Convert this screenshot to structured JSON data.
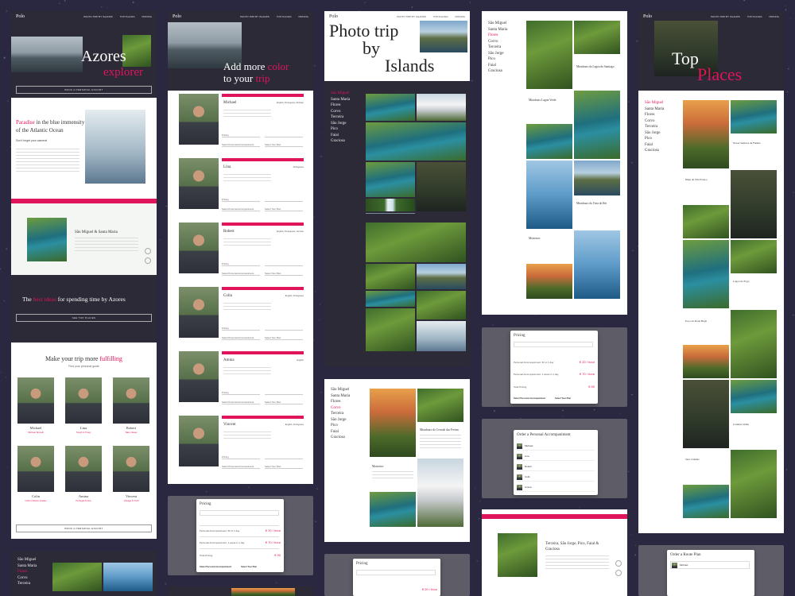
{
  "brand": "Polo",
  "nav": [
    "PHOTO TRIP BY ISLANDS",
    "TOP PLACES",
    "PRICING"
  ],
  "hero": {
    "title": "Azores",
    "subtitle": "explorer",
    "cta": "BOOK A PERSONAL ESCORT"
  },
  "paradise": {
    "highlight": "Paradise",
    "rest": " in the blue immensity of the Atlantic Ocean",
    "tagline": "Don't forget your camera!"
  },
  "region": {
    "title": "São Miguel & Santa Maria"
  },
  "best": {
    "prefix": "The ",
    "highlight": "best ideas",
    "suffix": " for spending time by Azores",
    "cta": "SEE TOP PLACES"
  },
  "guides_section": {
    "prefix": "Make your trip more ",
    "highlight": "fulfilling",
    "sub": "Find your personal guide",
    "cta": "BOOK A PERSONAL ESCORT"
  },
  "guides": [
    {
      "name": "Michael",
      "role": "Michael Spinelli"
    },
    {
      "name": "Lina",
      "role": "Tough & Trusty"
    },
    {
      "name": "Robert",
      "role": "Take it Easy"
    },
    {
      "name": "Colin",
      "role": "Colin's Nature Guides"
    },
    {
      "name": "Amina",
      "role": "Portugal Amina"
    },
    {
      "name": "Vincent",
      "role": "Vintage & Vivid"
    }
  ],
  "addmore": {
    "line1": "Add more ",
    "hl1": "color",
    "line2": "to your ",
    "hl2": "trip"
  },
  "guide_cards": [
    {
      "name": "Michael",
      "tag": "English, Portuguese, Russian"
    },
    {
      "name": "Lina",
      "tag": "Portuguese"
    },
    {
      "name": "Robert",
      "tag": "English, Portuguese, German"
    },
    {
      "name": "Colin",
      "tag": "English, Portuguese"
    },
    {
      "name": "Amina",
      "tag": "English"
    },
    {
      "name": "Vincent",
      "tag": "English, Portuguese"
    }
  ],
  "form_fields": {
    "a": "Pricing",
    "b": "Select Personal Accompaniment",
    "c": "Select Tour Plan"
  },
  "phototrip": {
    "line1": "Photo trip",
    "line2": "by",
    "line3": "Islands"
  },
  "islands": [
    "São Miguel",
    "Santa Maria",
    "Flores",
    "Corvo",
    "Terceira",
    "São Jorge",
    "Pico",
    "Faial",
    "Graciosa"
  ],
  "places_mid": [
    "Miradouro Lagoa Verde",
    "Miradouro da Vista do Rei",
    "Mosteiros",
    "Miradouro da Lagoa do Santiago",
    "Miradouro do Cerrado das Freiras"
  ],
  "place_right": [
    "Nossa Senhora de Fátima",
    "Ilhéu de Vila Franca",
    "Lagoa do Fogo",
    "Poço da Dona Beija",
    "Caldeira Velha",
    "Sete Cidades"
  ],
  "pricing": {
    "title": "Pricing",
    "row1": "Personal Accompaniment: 6h in 1 day",
    "row2": "Personal Accompaniment: 1 week in 1 day",
    "row3": "Total Pricing",
    "p1": "€ 20 / hour",
    "p2": "€ 70 / hour",
    "p3": "€ 90",
    "b1": "Select Personal Accompaniment",
    "b2": "Select Tour Plan"
  },
  "order": {
    "title": "Order a Personal Accompaniment",
    "items": [
      "Michael",
      "Lina",
      "Robert",
      "Colin",
      "Amina"
    ]
  },
  "route": {
    "title": "Order a Route Plan",
    "item": "Michael"
  },
  "tiles": {
    "title": "Terceira, São Jorge, Pico, Faial & Graciosa"
  },
  "top": {
    "line1": "Top",
    "line2": "Places"
  },
  "caption": "Miradouro Lagoa Verde"
}
